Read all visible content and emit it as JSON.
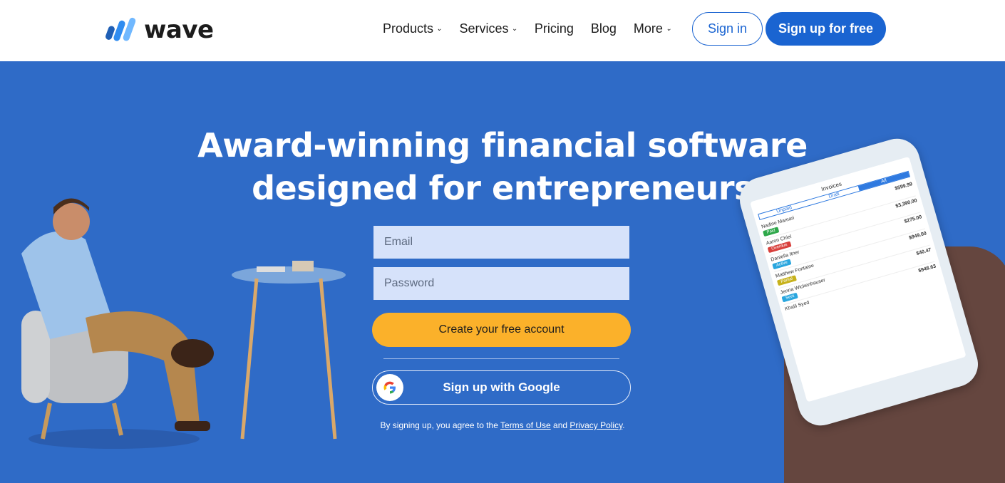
{
  "brand": {
    "name": "wave",
    "colors": {
      "primary": "#1a64d1",
      "hero": "#2f6bc7",
      "cta": "#fbb12a"
    }
  },
  "nav": {
    "items": [
      {
        "label": "Products",
        "dropdown": true
      },
      {
        "label": "Services",
        "dropdown": true
      },
      {
        "label": "Pricing",
        "dropdown": false
      },
      {
        "label": "Blog",
        "dropdown": false
      },
      {
        "label": "More",
        "dropdown": true
      }
    ],
    "signin": "Sign in",
    "signup": "Sign up for free"
  },
  "hero": {
    "headline_1": "Award-winning financial software",
    "headline_2": "designed for entrepreneurs"
  },
  "form": {
    "email_placeholder": "Email",
    "password_placeholder": "Password",
    "cta": "Create your free account",
    "google": "Sign up with Google",
    "legal_pre": "By signing up, you agree to the ",
    "terms": "Terms of Use",
    "legal_mid": " and ",
    "privacy": "Privacy Policy",
    "legal_post": "."
  },
  "phone": {
    "title": "Invoices",
    "tabs": [
      "Unpaid",
      "Draft",
      "All"
    ],
    "rows": [
      {
        "name": "Nadine Mamari",
        "amount": "$599.99",
        "status": "Paid"
      },
      {
        "name": "Aaron Chiel",
        "amount": "$3,390.00",
        "status": "Overdue"
      },
      {
        "name": "Daniella Itner",
        "amount": "$275.00",
        "status": "Active"
      },
      {
        "name": "Matthew Fontaine",
        "amount": "$949.00",
        "status": "Partial"
      },
      {
        "name": "Jenna Wickenhauser",
        "amount": "$40.47",
        "status": "Sent"
      },
      {
        "name": "Khalil Syed",
        "amount": "$948.63",
        "status": ""
      }
    ]
  }
}
